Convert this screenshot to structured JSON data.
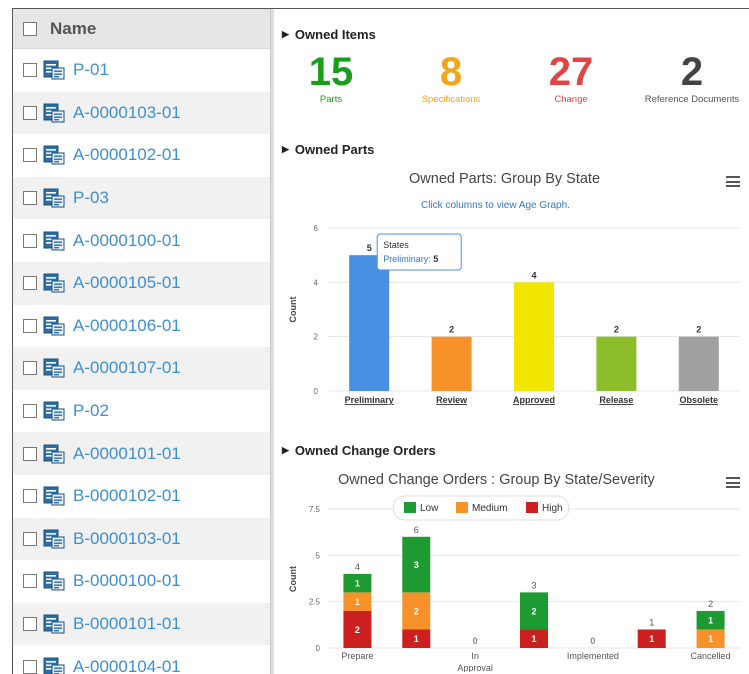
{
  "list": {
    "header": "Name",
    "items": [
      {
        "label": "P-01"
      },
      {
        "label": "A-0000103-01"
      },
      {
        "label": "A-0000102-01"
      },
      {
        "label": "P-03"
      },
      {
        "label": "A-0000100-01"
      },
      {
        "label": "A-0000105-01"
      },
      {
        "label": "A-0000106-01"
      },
      {
        "label": "A-0000107-01"
      },
      {
        "label": "P-02"
      },
      {
        "label": "A-0000101-01"
      },
      {
        "label": "B-0000102-01"
      },
      {
        "label": "B-0000103-01"
      },
      {
        "label": "B-0000100-01"
      },
      {
        "label": "B-0000101-01"
      },
      {
        "label": "A-0000104-01"
      }
    ]
  },
  "owned_items": {
    "title": "Owned Items",
    "metrics": [
      {
        "value": "15",
        "label": "Parts",
        "color": "#1a9e1a"
      },
      {
        "value": "8",
        "label": "Specifications",
        "color": "#f2a516"
      },
      {
        "value": "27",
        "label": "Change",
        "color": "#e04545"
      },
      {
        "value": "2",
        "label": "Reference Documents",
        "color": "#444444"
      }
    ]
  },
  "owned_parts": {
    "title": "Owned Parts",
    "tooltip": {
      "title": "States",
      "label": "Preliminary:",
      "value": "5"
    }
  },
  "owned_change_orders": {
    "title": "Owned Change Orders"
  },
  "chart_data": [
    {
      "type": "bar",
      "title": "Owned Parts: Group By State",
      "subtitle": "Click columns to view Age Graph.",
      "ylabel": "Count",
      "ylim": [
        0,
        6
      ],
      "yticks": [
        0,
        2,
        4,
        6
      ],
      "categories": [
        "Preliminary",
        "Review",
        "Approved",
        "Release",
        "Obsolete"
      ],
      "values": [
        5,
        2,
        4,
        2,
        2
      ],
      "colors": [
        "#4a90e2",
        "#f7922a",
        "#f2e600",
        "#8bbd2a",
        "#a0a0a0"
      ],
      "grid": true
    },
    {
      "type": "bar",
      "stacked": true,
      "title": "Owned Change Orders : Group By State/Severity",
      "ylabel": "Count",
      "ylim": [
        0,
        7.5
      ],
      "yticks": [
        0,
        2.5,
        5,
        7.5
      ],
      "ytick_labels": [
        "0",
        "2.5",
        "5",
        "7.5"
      ],
      "legend_position": "top",
      "categories": [
        "Prepare",
        "",
        "In Approval",
        "",
        "Implemented",
        "",
        "Cancelled"
      ],
      "axis_labels": [
        "Prepare",
        "In\nApproval",
        "Implemented",
        "Cancelled"
      ],
      "series": [
        {
          "name": "High",
          "color": "#cc1f1f",
          "values": [
            2,
            1,
            0,
            1,
            0,
            1,
            0
          ]
        },
        {
          "name": "Medium",
          "color": "#f7922a",
          "values": [
            1,
            2,
            0,
            0,
            0,
            0,
            1
          ]
        },
        {
          "name": "Low",
          "color": "#1e9a32",
          "values": [
            1,
            3,
            0,
            2,
            0,
            0,
            1
          ]
        }
      ],
      "legend_order": [
        "Low",
        "Medium",
        "High"
      ],
      "totals": [
        4,
        6,
        0,
        3,
        0,
        1,
        2
      ]
    }
  ]
}
